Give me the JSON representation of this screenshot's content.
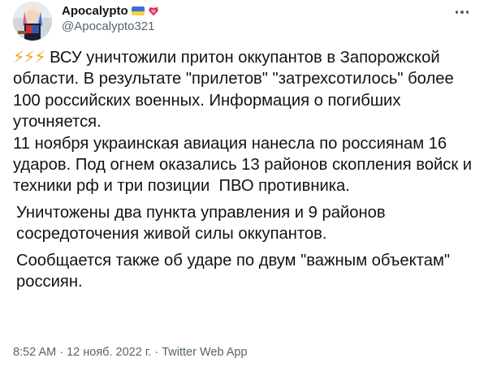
{
  "author": {
    "display_name": "Apocalypto",
    "handle": "@Apocalypto321",
    "flag_icon": "ukraine-flag-icon",
    "heart_icon": "sparkling-heart-icon"
  },
  "tweet": {
    "bolts": "⚡⚡⚡",
    "line_1": " ВСУ уничтожили притон оккупантов в Запорожской области. В результате \"прилетов\" \"затрехсотилось\" более 100 российских военных. Информация о погибших уточняется.",
    "line_2": "11 ноября украинская авиация нанесла по россиянам 16 ударов. Под огнем оказались 13 районов скопления войск и техники рф и три позиции  ПВО противника.",
    "line_3": "Уничтожены два пункта управления и 9 районов сосредоточения живой силы оккупантов.",
    "line_4": "Сообщается также об ударе по двум \"важным объектам\" россиян."
  },
  "meta": {
    "timestamp": "8:52 AM · 12 нояб. 2022 г. · Twitter Web App"
  },
  "colors": {
    "text": "#0f1419",
    "secondary": "#536471",
    "bolt": "#f4a21c"
  }
}
